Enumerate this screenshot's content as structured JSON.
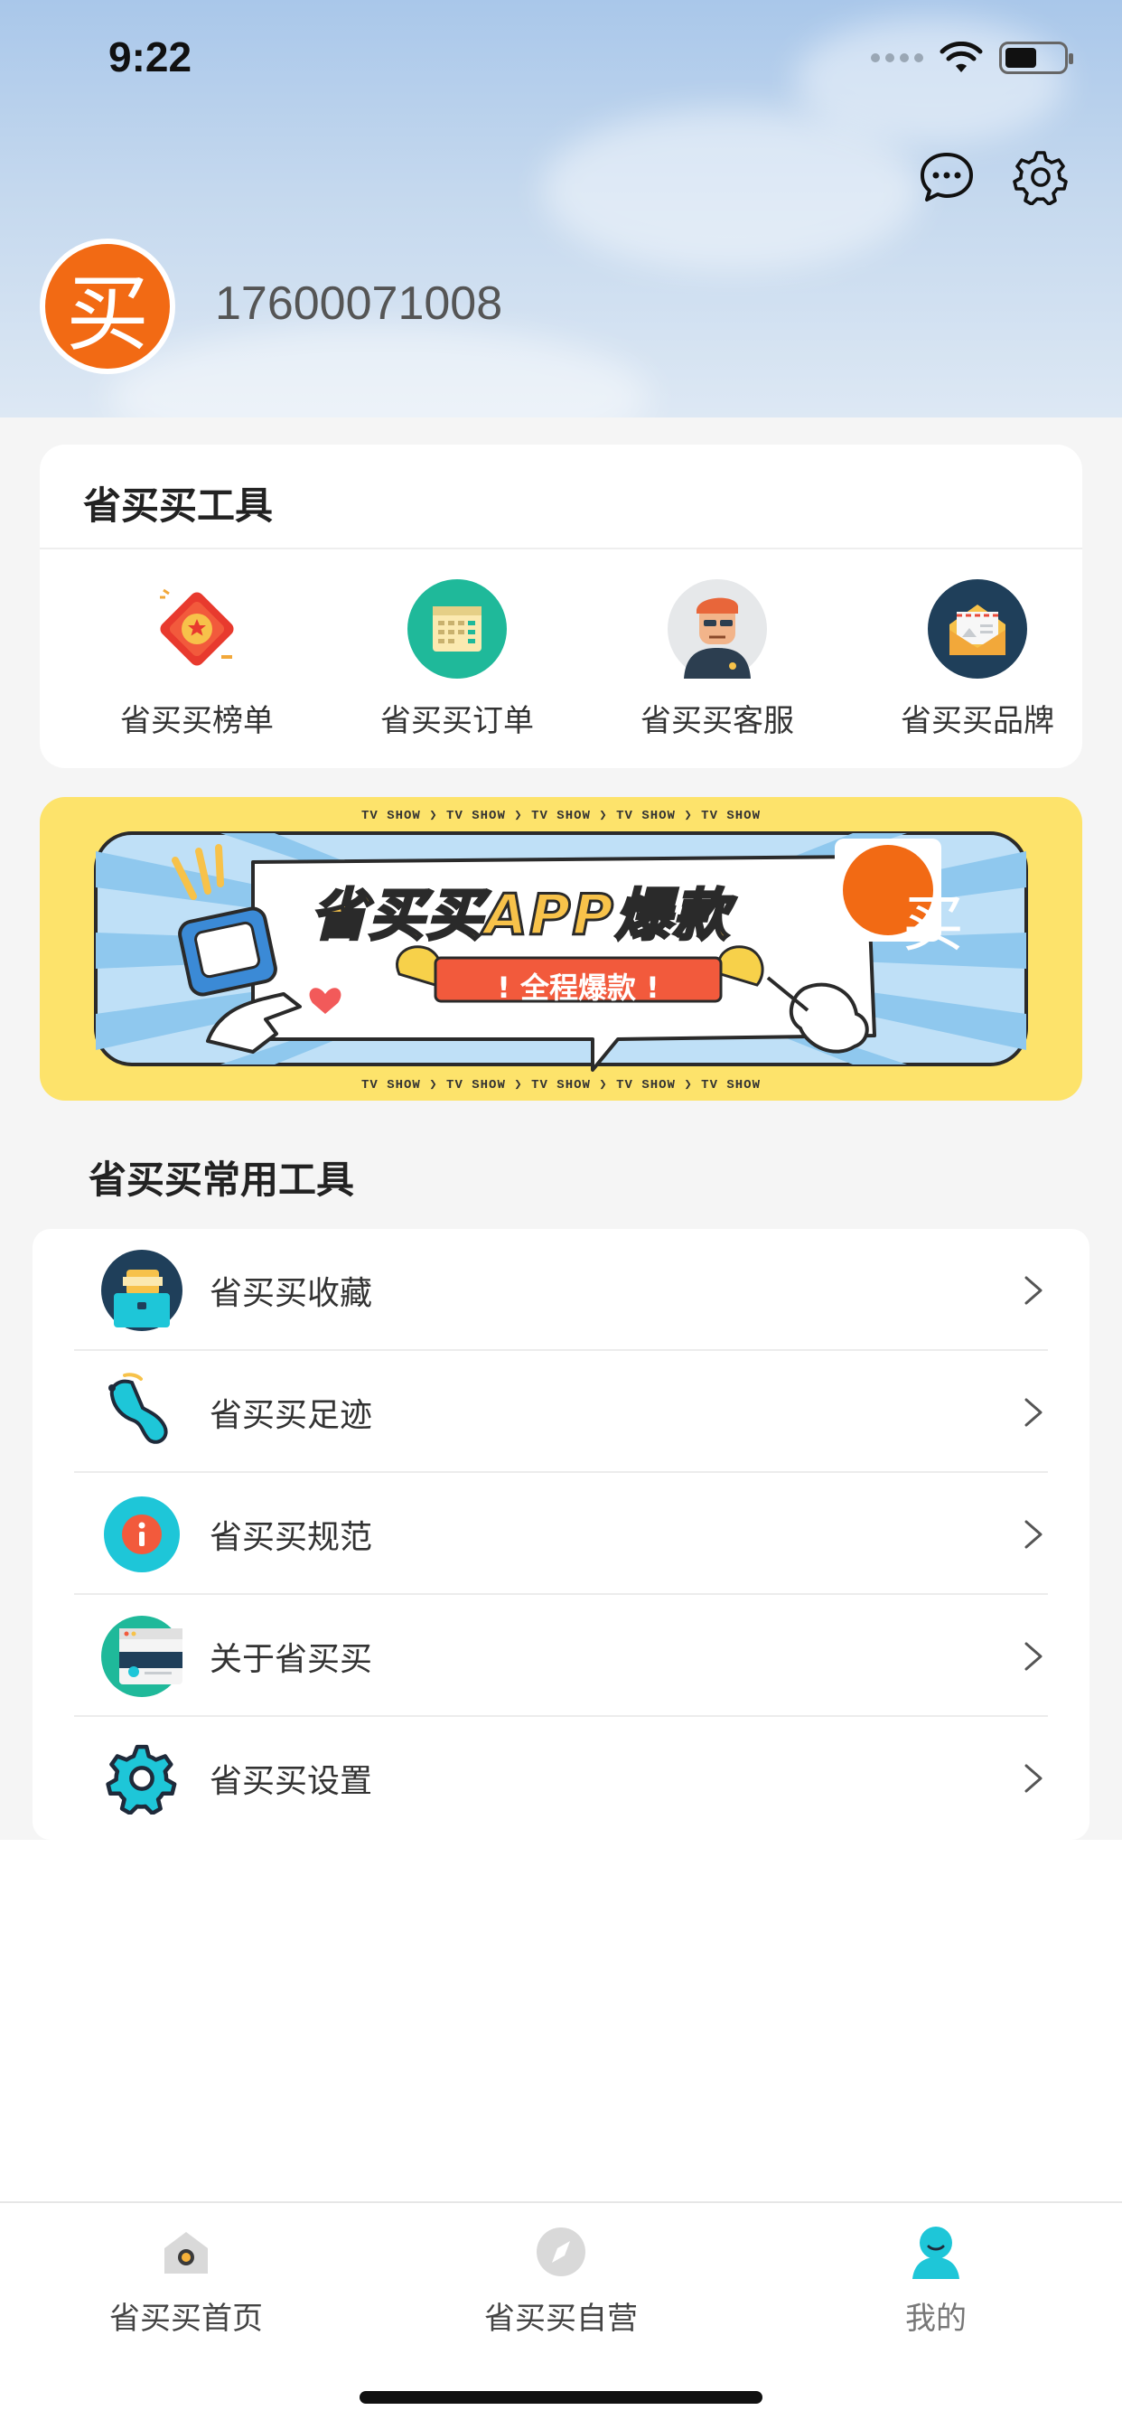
{
  "status_bar": {
    "time": "9:22"
  },
  "profile": {
    "avatar_char": "买",
    "phone": "17600071008"
  },
  "tools": {
    "title": "省买买工具",
    "items": [
      {
        "label": "省买买榜单",
        "icon": "ranking-badge-icon"
      },
      {
        "label": "省买买订单",
        "icon": "order-calendar-icon"
      },
      {
        "label": "省买买客服",
        "icon": "customer-service-icon"
      },
      {
        "label": "省买买品牌",
        "icon": "brand-envelope-icon"
      }
    ]
  },
  "banner": {
    "tv_text": "TV SHOW  ❯  TV SHOW  ❯  TV SHOW  ❯  TV SHOW  ❯  TV SHOW",
    "headline": "省买买APP爆款",
    "subline": "! 全程爆款 !",
    "logo_char": "买"
  },
  "common_tools": {
    "title": "省买买常用工具",
    "items": [
      {
        "label": "省买买收藏",
        "icon": "favorites-box-icon"
      },
      {
        "label": "省买买足迹",
        "icon": "footprint-icon"
      },
      {
        "label": "省买买规范",
        "icon": "info-icon"
      },
      {
        "label": "关于省买买",
        "icon": "about-window-icon"
      },
      {
        "label": "省买买设置",
        "icon": "settings-gear-icon"
      }
    ]
  },
  "tabbar": {
    "items": [
      {
        "label": "省买买首页",
        "icon": "home-icon"
      },
      {
        "label": "省买买自营",
        "icon": "compass-icon"
      },
      {
        "label": "我的",
        "icon": "profile-icon",
        "active": true
      }
    ]
  },
  "colors": {
    "accent": "#f26a14",
    "teal": "#1ec6d8",
    "banner_yellow": "#fde36b"
  }
}
